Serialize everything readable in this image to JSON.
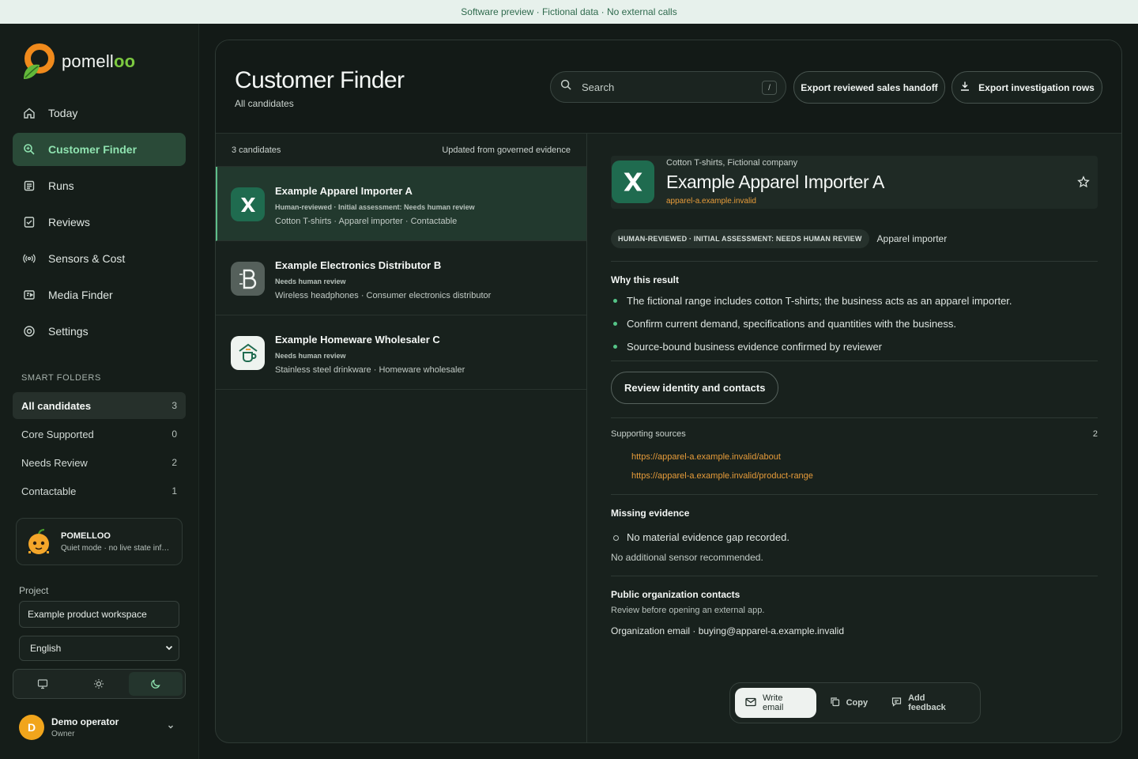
{
  "banner": "Software preview · Fictional data · No external calls",
  "brand": {
    "name_main": "pomell",
    "name_accent": "oo"
  },
  "nav": [
    {
      "label": "Today",
      "icon": "home-icon"
    },
    {
      "label": "Customer Finder",
      "icon": "search-icon",
      "active": true
    },
    {
      "label": "Runs",
      "icon": "list-icon"
    },
    {
      "label": "Reviews",
      "icon": "clipboard-check-icon"
    },
    {
      "label": "Sensors & Cost",
      "icon": "signal-icon"
    },
    {
      "label": "Media Finder",
      "icon": "media-icon"
    },
    {
      "label": "Settings",
      "icon": "gear-icon"
    }
  ],
  "smart_folders": {
    "title": "SMART FOLDERS",
    "items": [
      {
        "label": "All candidates",
        "count": "3",
        "active": true
      },
      {
        "label": "Core Supported",
        "count": "0"
      },
      {
        "label": "Needs Review",
        "count": "2"
      },
      {
        "label": "Contactable",
        "count": "1"
      }
    ]
  },
  "mascot": {
    "title": "POMELLOO",
    "subtitle": "Quiet mode · no live state information"
  },
  "project": {
    "label": "Project",
    "value": "Example product workspace"
  },
  "language": {
    "value": "English"
  },
  "theme": {
    "options": [
      "monitor-icon",
      "sun-icon",
      "moon-icon"
    ],
    "active": "moon-icon"
  },
  "user": {
    "initial": "D",
    "name": "Demo operator",
    "role": "Owner"
  },
  "header": {
    "title": "Customer Finder",
    "subtitle": "All candidates",
    "search_placeholder": "Search",
    "search_shortcut": "/",
    "export_handoff": "Export reviewed sales handoff",
    "export_rows": "Export investigation rows"
  },
  "list": {
    "count_label": "3 candidates",
    "updated_label": "Updated from governed evidence",
    "rows": [
      {
        "name": "Example Apparel Importer A",
        "status": "Human-reviewed · Initial assessment: Needs human review",
        "tags": "Cotton T-shirts  ·  Apparel importer  ·  Contactable",
        "logo": "x-logo",
        "color": "#1f6b4f"
      },
      {
        "name": "Example Electronics Distributor B",
        "status": "Needs human review",
        "tags": "Wireless headphones  ·  Consumer electronics distributor",
        "logo": "b-logo",
        "color": "#55605b"
      },
      {
        "name": "Example Homeware Wholesaler C",
        "status": "Needs human review",
        "tags": "Stainless steel drinkware  ·  Homeware wholesaler",
        "logo": "cup-logo",
        "color": "#eef3ef"
      }
    ]
  },
  "detail": {
    "category": "Cotton T-shirts, Fictional company",
    "name": "Example Apparel Importer A",
    "domain": "apparel-a.example.invalid",
    "badge": "HUMAN-REVIEWED · INITIAL ASSESSMENT: NEEDS HUMAN REVIEW",
    "role": "Apparel importer",
    "why_title": "Why this result",
    "why": [
      "The fictional range includes cotton T-shirts; the business acts as an apparel importer.",
      "Confirm current demand, specifications and quantities with the business.",
      "Source-bound business evidence confirmed by reviewer"
    ],
    "review_button": "Review identity and contacts",
    "sources_title": "Supporting sources",
    "sources_count": "2",
    "sources": [
      "https://apparel-a.example.invalid/about",
      "https://apparel-a.example.invalid/product-range"
    ],
    "missing_title": "Missing evidence",
    "missing": [
      "No material evidence gap recorded."
    ],
    "sensor_note": "No additional sensor recommended.",
    "contacts_title": "Public organization contacts",
    "contacts_note": "Review before opening an external app.",
    "contact_line": "Organization email · buying@apparel-a.example.invalid"
  },
  "actions": {
    "write_email": "Write email",
    "copy": "Copy",
    "feedback": "Add feedback"
  },
  "colors": {
    "accent": "#8fe3b0",
    "link": "#e79c3a",
    "active_row": "#22392e"
  }
}
